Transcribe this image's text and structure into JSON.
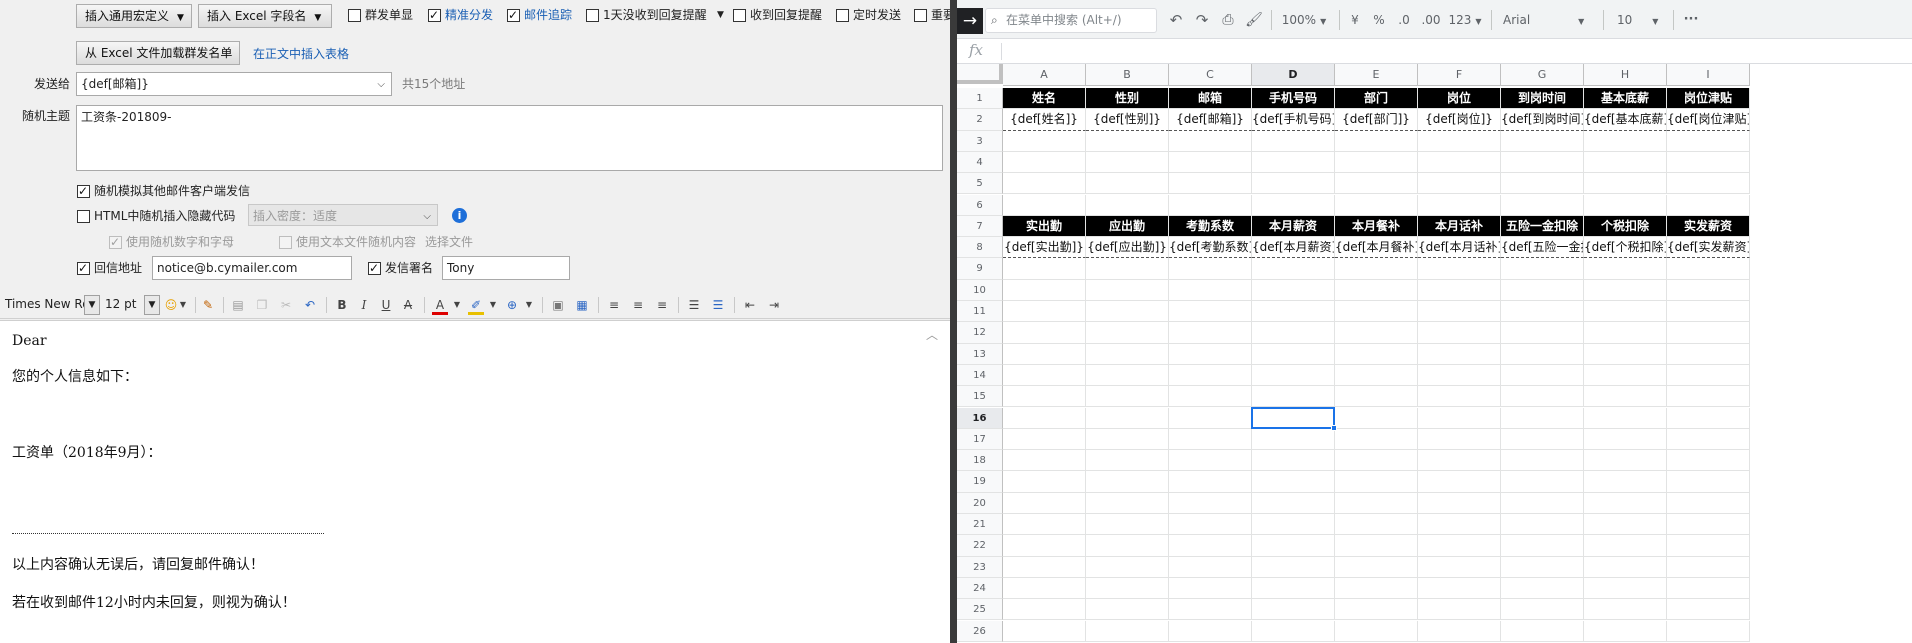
{
  "composer": {
    "buttons": {
      "insert_macro": "插入通用宏定义",
      "insert_excel_field": "插入 Excel 字段名",
      "load_excel": "从 Excel 文件加载群发名单"
    },
    "options": {
      "group_single": {
        "label": "群发单显",
        "checked": false
      },
      "precise_send": {
        "label": "精准分发",
        "checked": true
      },
      "mail_tracking": {
        "label": "邮件追踪",
        "checked": true
      },
      "no_reply_reminder": {
        "label": "1天没收到回复提醒",
        "checked": false
      },
      "reply_reminder": {
        "label": "收到回复提醒",
        "checked": false
      },
      "scheduled_send": {
        "label": "定时发送",
        "checked": false
      },
      "important": {
        "label": "重要",
        "checked": false
      }
    },
    "insert_table_link": "在正文中插入表格",
    "send_to_label": "发送给",
    "send_to_value": "{def[邮箱]}",
    "address_count": "共15个地址",
    "subject_label": "随机主题",
    "subject_value": "工资条-201809-",
    "simulate_client": {
      "label": "随机模拟其他邮件客户端发信",
      "checked": true
    },
    "html_hidden_code": {
      "label": "HTML中随机插入隐藏代码",
      "checked": false
    },
    "insert_density": "插入密度：适度",
    "use_random_chars": {
      "label": "使用随机数字和字母",
      "checked": true
    },
    "use_text_file": {
      "label": "使用文本文件随机内容",
      "checked": false
    },
    "choose_file": "选择文件",
    "reply_addr": {
      "label": "回信地址",
      "checked": true,
      "value": "notice@b.cymailer.com"
    },
    "sender_sign": {
      "label": "发信署名",
      "checked": true,
      "value": "Tony"
    }
  },
  "editor_toolbar": {
    "font": "Times New Ro",
    "size": "12 pt"
  },
  "mail_body": {
    "lines": [
      "Dear",
      "您的个人信息如下：",
      "工资单（2018年9月）：",
      "以上内容确认无误后，请回复邮件确认！",
      "若在收到邮件12小时内未回复，则视为确认！"
    ]
  },
  "sheet": {
    "toolbar": {
      "search_placeholder": "在菜单中搜索 (Alt+/)",
      "zoom": "100%",
      "currency": "¥",
      "percent": "%",
      "dec_less": ".0",
      "dec_more": ".00",
      "num_format": "123",
      "font": "Arial",
      "font_size": "10",
      "more": "···"
    },
    "fx": "fx",
    "columns": [
      "A",
      "B",
      "C",
      "D",
      "E",
      "F",
      "G",
      "H",
      "I"
    ],
    "active_column": "D",
    "active_row": "16",
    "rows": [
      "1",
      "2",
      "3",
      "4",
      "5",
      "6",
      "7",
      "8",
      "9",
      "10",
      "11",
      "12",
      "13",
      "14",
      "15",
      "16",
      "17",
      "18",
      "19",
      "20",
      "21",
      "22",
      "23",
      "24",
      "25",
      "26"
    ],
    "row1": [
      "姓名",
      "性别",
      "邮箱",
      "手机号码",
      "部门",
      "岗位",
      "到岗时间",
      "基本底薪",
      "岗位津贴"
    ],
    "row2": [
      "{def[姓名]}",
      "{def[性别]}",
      "{def[邮箱]}",
      "{def[手机号码]}",
      "{def[部门]}",
      "{def[岗位]}",
      "{def[到岗时间]}",
      "{def[基本底薪]}",
      "{def[岗位津贴]}"
    ],
    "row7": [
      "实出勤",
      "应出勤",
      "考勤系数",
      "本月薪资",
      "本月餐补",
      "本月话补",
      "五险一金扣除",
      "个税扣除",
      "实发薪资"
    ],
    "row8": [
      "{def[实出勤]}",
      "{def[应出勤]}",
      "{def[考勤系数]}",
      "{def[本月薪资]}",
      "{def[本月餐补]}",
      "{def[本月话补]}",
      "{def[五险一金扣除]}",
      "{def[个税扣除]}",
      "{def[实发薪资]}"
    ]
  }
}
